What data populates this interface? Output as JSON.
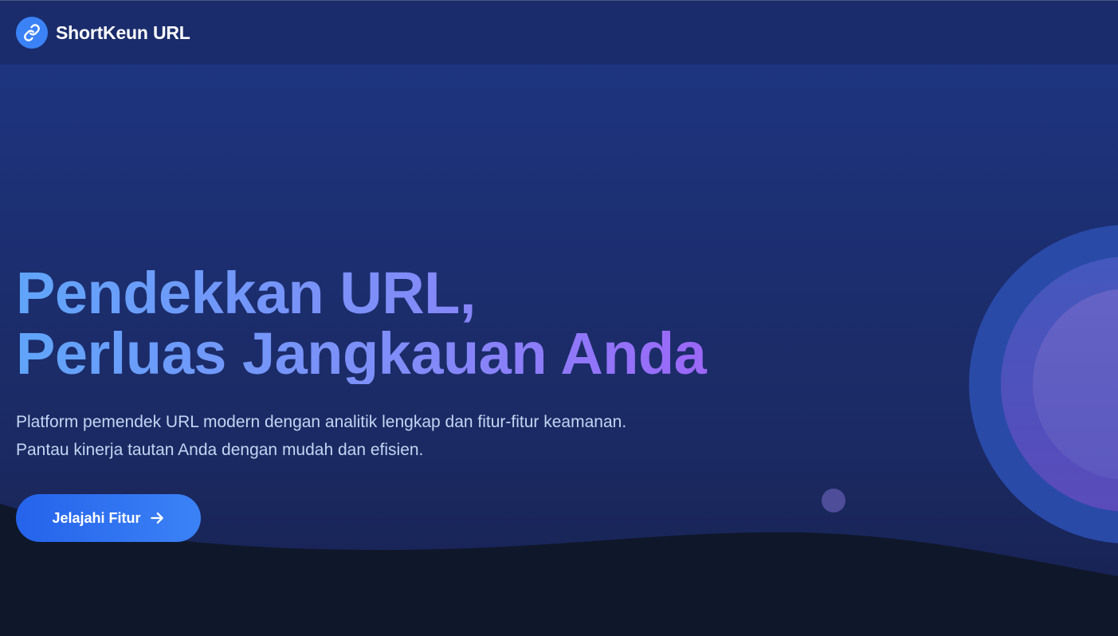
{
  "navbar": {
    "logo_icon": "link-icon",
    "brand": "ShortKeun URL"
  },
  "hero": {
    "title_line1": "Pendekkan URL,",
    "title_line2": "Perluas Jangkauan Anda",
    "description_line1": "Platform pemendek URL modern dengan analitik lengkap dan fitur-fitur keamanan.",
    "description_line2": "Pantau kinerja tautan Anda dengan mudah dan efisien.",
    "cta_label": "Jelajahi Fitur",
    "cta_icon": "arrow-right-icon"
  },
  "colors": {
    "accent": "#3b82f6",
    "gradient_start": "#60a5fa",
    "gradient_end": "#a855f7",
    "background_dark": "#0f172a"
  }
}
